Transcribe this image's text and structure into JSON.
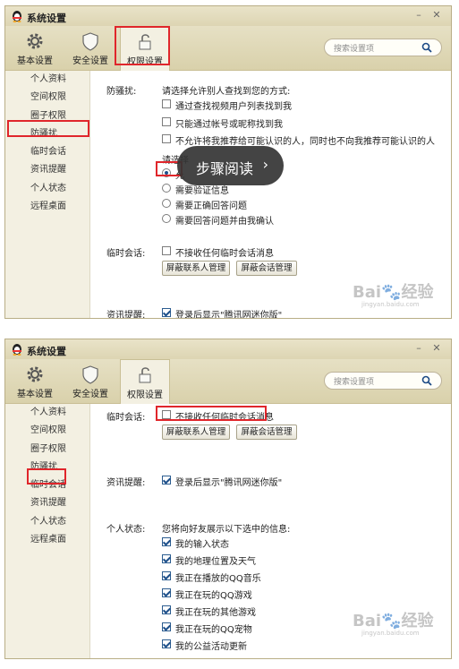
{
  "window1": {
    "title": "系统设置",
    "toolbar": [
      "基本设置",
      "安全设置",
      "权限设置"
    ],
    "search_placeholder": "搜索设置项",
    "sidebar": [
      "个人资料",
      "空间权限",
      "圈子权限",
      "防骚扰",
      "临时会话",
      "资讯提醒",
      "个人状态",
      "远程桌面"
    ],
    "anti_harass_label": "防骚扰:",
    "find_prompt": "请选择允许别人查找到您的方式:",
    "find_options": [
      "通过查找视频用户列表找到我",
      "只能通过帐号或昵称找到我",
      "不允许将我推荐给可能认识的人，同时也不向我推荐可能认识的人"
    ],
    "verify_prompt": "请选择",
    "verify_options": [
      "允",
      "需要验证信息",
      "需要正确回答问题",
      "需要回答问题并由我确认"
    ],
    "temp_session_label": "临时会话:",
    "temp_session_option": "不接收任何临时会话消息",
    "block_contacts_button": "屏蔽联系人管理",
    "block_sessions_button": "屏蔽会话管理",
    "news_label": "资讯提醒:",
    "news_option": "登录后显示\"腾讯网迷你版\"",
    "overlay_text": "步骤阅读",
    "overlay_arrow": "›"
  },
  "window2": {
    "title": "系统设置",
    "toolbar": [
      "基本设置",
      "安全设置",
      "权限设置"
    ],
    "search_placeholder": "搜索设置项",
    "sidebar": [
      "个人资料",
      "空间权限",
      "圈子权限",
      "防骚扰",
      "临时会话",
      "资讯提醒",
      "个人状态",
      "远程桌面"
    ],
    "temp_session_label": "临时会话:",
    "temp_session_option": "不接收任何临时会话消息",
    "block_contacts_button": "屏蔽联系人管理",
    "block_sessions_button": "屏蔽会话管理",
    "news_label": "资讯提醒:",
    "news_option": "登录后显示\"腾讯网迷你版\"",
    "status_label": "个人状态:",
    "status_prompt": "您将向好友展示以下选中的信息:",
    "status_items": [
      "我的输入状态",
      "我的地理位置及天气",
      "我正在播放的QQ音乐",
      "我正在玩的QQ游戏",
      "我正在玩的其他游戏",
      "我正在玩的QQ宠物",
      "我的公益活动更新"
    ]
  },
  "watermark": {
    "brand": "Bai",
    "brand_cn": "经验",
    "url": "jingyan.baidu.com"
  },
  "colors": {
    "highlight_red": "#e0262b",
    "window_bg": "#f3f0e2",
    "toolbar_bg": "#ddd5b3"
  }
}
